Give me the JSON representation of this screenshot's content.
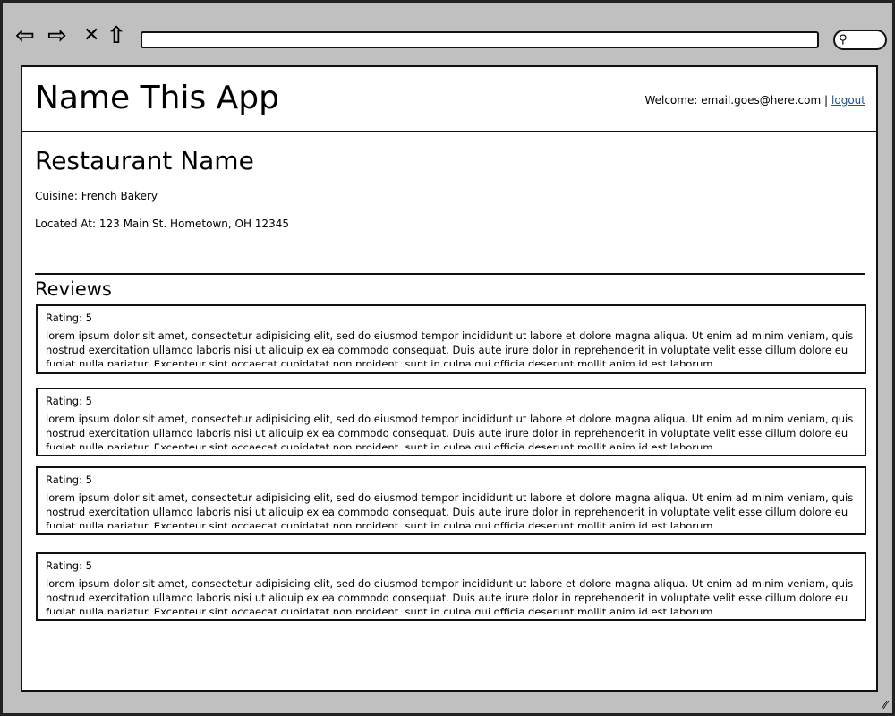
{
  "browser": {
    "icons": [
      "back-arrow-icon",
      "forward-arrow-icon",
      "close-icon",
      "home-icon",
      "search-icon"
    ],
    "url": ""
  },
  "header": {
    "app_title": "Name This App",
    "welcome": "Welcome: email.goes@here.com |",
    "logout": "logout"
  },
  "restaurant": {
    "name": "Restaurant Name",
    "cuisine": "Cuisine: French Bakery",
    "location": "Located At: 123 Main St. Hometown, OH 12345"
  },
  "reviews": {
    "title": "Reviews",
    "items": [
      {
        "rating": "Rating: 5",
        "text": "lorem ipsum dolor sit amet, consectetur adipisicing elit, sed do eiusmod tempor incididunt ut labore et dolore magna aliqua. Ut enim ad minim veniam, quis nostrud exercitation ullamco laboris nisi ut aliquip ex ea commodo consequat. Duis aute irure dolor in reprehenderit in voluptate velit esse cillum dolore eu fugiat nulla pariatur. Excepteur sint occaecat cupidatat non proident, sunt in culpa qui officia deserunt mollit anim id est laborum."
      },
      {
        "rating": "Rating: 5",
        "text": "lorem ipsum dolor sit amet, consectetur adipisicing elit, sed do eiusmod tempor incididunt ut labore et dolore magna aliqua. Ut enim ad minim veniam, quis nostrud exercitation ullamco laboris nisi ut aliquip ex ea commodo consequat. Duis aute irure dolor in reprehenderit in voluptate velit esse cillum dolore eu fugiat nulla pariatur. Excepteur sint occaecat cupidatat non proident, sunt in culpa qui officia deserunt mollit anim id est laborum."
      },
      {
        "rating": "Rating: 5",
        "text": "lorem ipsum dolor sit amet, consectetur adipisicing elit, sed do eiusmod tempor incididunt ut labore et dolore magna aliqua. Ut enim ad minim veniam, quis nostrud exercitation ullamco laboris nisi ut aliquip ex ea commodo consequat. Duis aute irure dolor in reprehenderit in voluptate velit esse cillum dolore eu fugiat nulla pariatur. Excepteur sint occaecat cupidatat non proident, sunt in culpa qui officia deserunt mollit anim id est laborum."
      },
      {
        "rating": "Rating: 5",
        "text": "lorem ipsum dolor sit amet, consectetur adipisicing elit, sed do eiusmod tempor incididunt ut labore et dolore magna aliqua. Ut enim ad minim veniam, quis nostrud exercitation ullamco laboris nisi ut aliquip ex ea commodo consequat. Duis aute irure dolor in reprehenderit in voluptate velit esse cillum dolore eu fugiat nulla pariatur. Excepteur sint occaecat cupidatat non proident, sunt in culpa qui officia deserunt mollit anim id est laborum."
      }
    ]
  }
}
